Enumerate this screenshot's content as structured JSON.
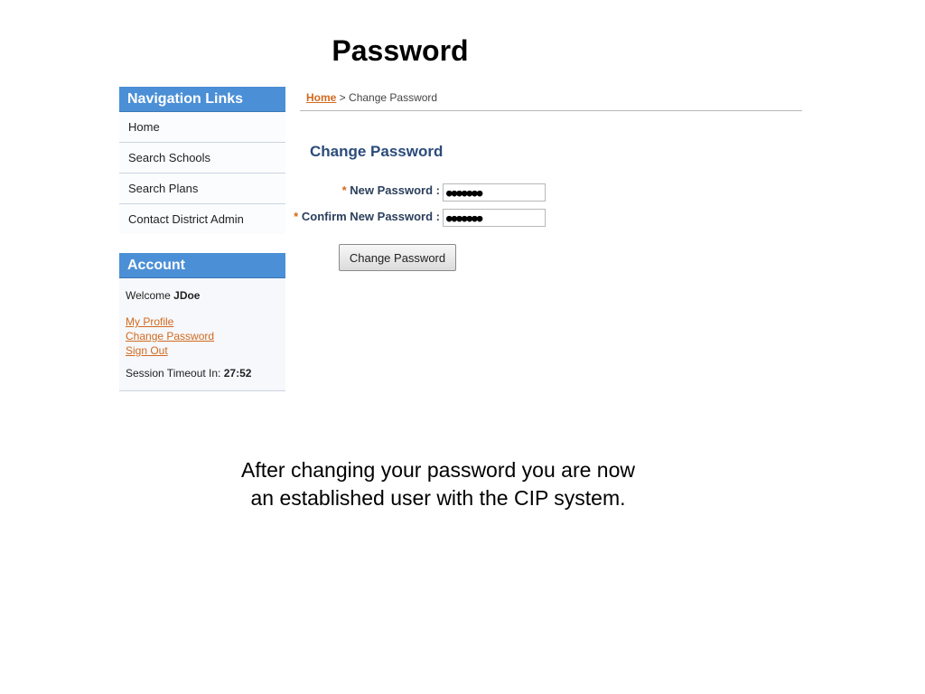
{
  "slide": {
    "title": "Password",
    "caption_line1": "After changing your password you are now",
    "caption_line2": "an established user with the CIP system."
  },
  "navigation": {
    "header": "Navigation Links",
    "items": [
      {
        "label": "Home"
      },
      {
        "label": "Search Schools"
      },
      {
        "label": "Search Plans"
      },
      {
        "label": "Contact District Admin"
      }
    ]
  },
  "account": {
    "header": "Account",
    "welcome_prefix": "Welcome",
    "username": "JDoe",
    "links": [
      {
        "label": "My Profile"
      },
      {
        "label": "Change Password"
      },
      {
        "label": "Sign Out"
      }
    ],
    "timeout_label": "Session Timeout In:",
    "timeout_value": "27:52"
  },
  "breadcrumb": {
    "home": "Home",
    "separator": " > ",
    "current": "Change Password"
  },
  "form": {
    "title": "Change Password",
    "required_marker": "*",
    "new_password_label": "New Password :",
    "new_password_value": "●●●●●●●",
    "confirm_password_label": "Confirm New Password :",
    "confirm_password_value": "●●●●●●●",
    "submit_label": "Change Password"
  },
  "colors": {
    "panel_header": "#4b8fd6",
    "link": "#d2691e",
    "form_title": "#2b4b7a"
  }
}
